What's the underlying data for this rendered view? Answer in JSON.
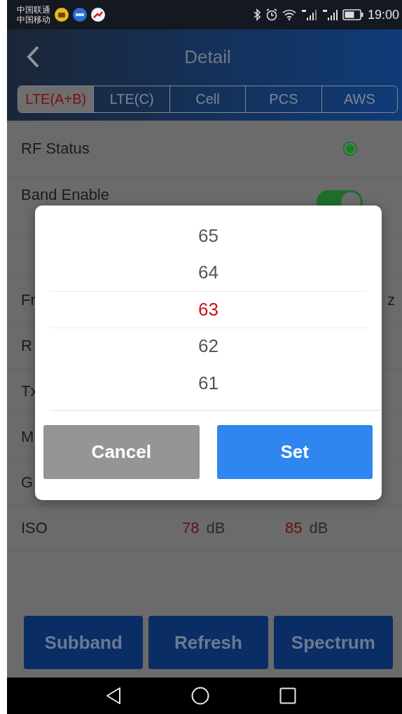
{
  "status_bar": {
    "carriers": [
      "中国联通",
      "中国移动"
    ],
    "time": "19:00"
  },
  "header": {
    "title": "Detail"
  },
  "tabs": [
    {
      "label": "LTE(A+B)",
      "selected": true
    },
    {
      "label": "LTE(C)",
      "selected": false
    },
    {
      "label": "Cell",
      "selected": false
    },
    {
      "label": "PCS",
      "selected": false
    },
    {
      "label": "AWS",
      "selected": false
    }
  ],
  "rows": [
    {
      "kind": "status",
      "label": "RF Status",
      "on": true
    },
    {
      "kind": "toggle",
      "label": "Band Enable",
      "on": true
    },
    {
      "kind": "blank"
    },
    {
      "kind": "value",
      "label": "Fr",
      "right": "z"
    },
    {
      "kind": "label",
      "label": "R"
    },
    {
      "kind": "label",
      "label": "Tx"
    },
    {
      "kind": "label",
      "label": "M"
    },
    {
      "kind": "label",
      "label": "G"
    },
    {
      "kind": "pair",
      "label": "ISO",
      "values": [
        {
          "value": "78",
          "unit": "dB"
        },
        {
          "value": "85",
          "unit": "dB"
        }
      ]
    }
  ],
  "dialog": {
    "items": [
      {
        "label": "65",
        "selected": false
      },
      {
        "label": "64",
        "selected": false
      },
      {
        "label": "63",
        "selected": true
      },
      {
        "label": "62",
        "selected": false
      },
      {
        "label": "61",
        "selected": false
      }
    ],
    "buttons": [
      {
        "kind": "cancel",
        "label": "Cancel"
      },
      {
        "kind": "confirm",
        "label": "Set"
      }
    ]
  },
  "actions": [
    "Subband",
    "Refresh",
    "Spectrum"
  ]
}
